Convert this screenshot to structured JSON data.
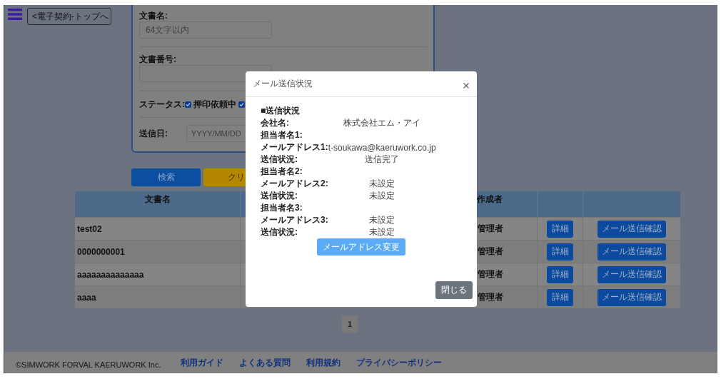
{
  "nav": {
    "back_link": "<電子契約-トップへ"
  },
  "search_form": {
    "fields": [
      {
        "label": "文書名:",
        "placeholder": "64文字以内"
      },
      {
        "label": "文書番号:"
      }
    ],
    "status": {
      "label": "ステータス:",
      "options": [
        {
          "label": "押印依頼中",
          "checked": true
        },
        {
          "checked": true
        }
      ]
    },
    "date": {
      "label": "送信日:",
      "placeholder": "YYYY/MM/DD"
    }
  },
  "form_buttons": [
    {
      "kind": "search",
      "label": "検索"
    },
    {
      "kind": "clear",
      "label": "クリ"
    }
  ],
  "table": {
    "columns": [
      "文書名",
      "作成者"
    ],
    "rows": [
      {
        "document_name": "test02",
        "creator": "管理者",
        "buttons": [
          "詳細",
          "メール送信確認"
        ]
      },
      {
        "document_name": "0000000001",
        "creator": "管理者",
        "buttons": [
          "詳細",
          "メール送信確認"
        ]
      },
      {
        "document_name": "aaaaaaaaaaaaaa",
        "creator": "管理者",
        "buttons": [
          "詳細",
          "メール送信確認"
        ]
      },
      {
        "document_name": "aaaa",
        "creator": "管理者",
        "buttons": [
          "詳細",
          "メール送信確認"
        ]
      }
    ]
  },
  "pagination": {
    "pages": [
      {
        "label": "1",
        "selected": true
      }
    ]
  },
  "footer": {
    "copyright": "©SIMWORK FORVAL KAERUWORK Inc.",
    "links": [
      "利用ガイド",
      "よくある質問",
      "利用規約",
      "プライバシーポリシー"
    ]
  },
  "dialog": {
    "title": "メール送信状況",
    "section_title": "■送信状況",
    "rows": [
      {
        "label": "会社名:",
        "value": "株式会社エム・アイ"
      },
      {
        "label": "担当者名1:"
      },
      {
        "label": "メールアドレス1:",
        "value": "t-soukawa@kaeruwork.co.jp"
      },
      {
        "label": "送信状況:",
        "value": "送信完了"
      },
      {
        "label": "担当者名2:"
      },
      {
        "label": "メールアドレス2:",
        "value": "未設定"
      },
      {
        "label": "送信状況:",
        "value": "未設定"
      },
      {
        "label": "担当者名3:"
      },
      {
        "label": "メールアドレス3:",
        "value": "未設定"
      },
      {
        "label": "送信状況:",
        "value": "未設定"
      }
    ],
    "change_button": "メールアドレス変更",
    "close_button": "閉じる"
  }
}
